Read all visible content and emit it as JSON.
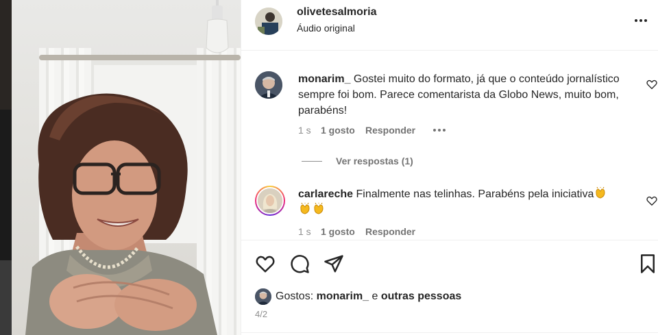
{
  "post": {
    "username": "olivetesalmoria",
    "audio": "Áudio original",
    "more_icon": "more-horizontal-icon"
  },
  "comments": [
    {
      "username": "monarim_",
      "text": "Gostei muito do formato, já que o conteúdo jornalístico sempre foi bom. Parece comentarista da Globo News, muito bom, parabéns!",
      "time": "1 s",
      "likes": "1 gosto",
      "reply": "Responder",
      "view_replies": "Ver respostas (1)"
    },
    {
      "username": "carlareche",
      "text": "Finalmente nas telinhas. Parabéns pela iniciativa",
      "time": "1 s",
      "likes": "1 gosto",
      "reply": "Responder"
    }
  ],
  "actions": {
    "like_icon": "heart-icon",
    "comment_icon": "comment-icon",
    "share_icon": "send-icon",
    "save_icon": "bookmark-icon"
  },
  "likes_summary": {
    "prefix": "Gostos:",
    "user": "monarim_",
    "connector": "e",
    "others": "outras pessoas"
  },
  "date": "4/2",
  "colors": {
    "text": "#262626",
    "secondary": "#8e8e8e",
    "border": "#efefef"
  }
}
